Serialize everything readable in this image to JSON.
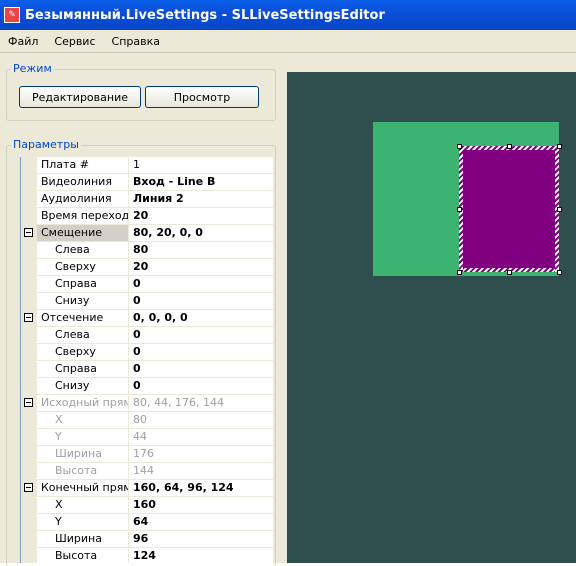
{
  "window": {
    "title": "Безымянный.LiveSettings - SLLiveSettingsEditor"
  },
  "menu": [
    "Файл",
    "Сервис",
    "Справка"
  ],
  "mode_group": {
    "label": "Режим",
    "edit_button": "Редактирование",
    "view_button": "Просмотр"
  },
  "params_group": {
    "label": "Параметры"
  },
  "properties": [
    {
      "name": "Плата #",
      "value": "1",
      "level": 0,
      "bold": false
    },
    {
      "name": "Видеолиния",
      "value": "Вход - Line B",
      "level": 0,
      "bold": true
    },
    {
      "name": "Аудиолиния",
      "value": "Линия 2",
      "level": 0,
      "bold": true
    },
    {
      "name": "Время перехода",
      "value": "20",
      "level": 0,
      "bold": true
    },
    {
      "name": "Смещение",
      "value": "80, 20, 0, 0",
      "level": 0,
      "bold": true,
      "expander": true,
      "selected": true
    },
    {
      "name": "Слева",
      "value": "80",
      "level": 1,
      "bold": true
    },
    {
      "name": "Сверху",
      "value": "20",
      "level": 1,
      "bold": true
    },
    {
      "name": "Справа",
      "value": "0",
      "level": 1,
      "bold": true
    },
    {
      "name": "Снизу",
      "value": "0",
      "level": 1,
      "bold": true
    },
    {
      "name": "Отсечение",
      "value": "0, 0, 0, 0",
      "level": 0,
      "bold": true,
      "expander": true
    },
    {
      "name": "Слева",
      "value": "0",
      "level": 1,
      "bold": true
    },
    {
      "name": "Сверху",
      "value": "0",
      "level": 1,
      "bold": true
    },
    {
      "name": "Справа",
      "value": "0",
      "level": 1,
      "bold": true
    },
    {
      "name": "Снизу",
      "value": "0",
      "level": 1,
      "bold": true
    },
    {
      "name": "Исходный прямоугольник",
      "value": "80, 44, 176, 144",
      "level": 0,
      "bold": false,
      "expander": true,
      "disabled": true
    },
    {
      "name": "X",
      "value": "80",
      "level": 1,
      "bold": false,
      "disabled": true
    },
    {
      "name": "Y",
      "value": "44",
      "level": 1,
      "bold": false,
      "disabled": true
    },
    {
      "name": "Ширина",
      "value": "176",
      "level": 1,
      "bold": false,
      "disabled": true
    },
    {
      "name": "Высота",
      "value": "144",
      "level": 1,
      "bold": false,
      "disabled": true
    },
    {
      "name": "Конечный прямоугольник",
      "value": "160, 64, 96, 124",
      "level": 0,
      "bold": true,
      "expander": true
    },
    {
      "name": "X",
      "value": "160",
      "level": 1,
      "bold": true
    },
    {
      "name": "Y",
      "value": "64",
      "level": 1,
      "bold": true
    },
    {
      "name": "Ширина",
      "value": "96",
      "level": 1,
      "bold": true
    },
    {
      "name": "Высота",
      "value": "124",
      "level": 1,
      "bold": true
    }
  ],
  "colors": {
    "canvas": "#2f4f4f",
    "source_rect": "#3cb371",
    "target_rect": "#800080"
  }
}
